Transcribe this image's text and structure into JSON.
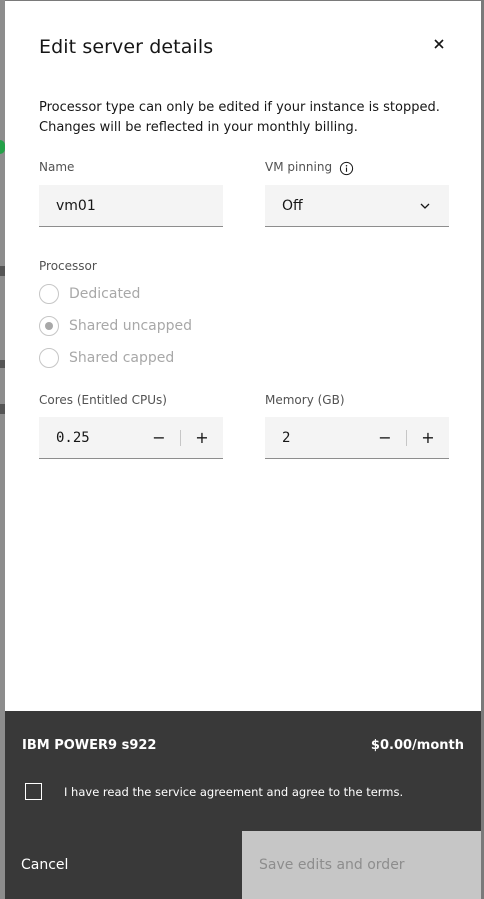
{
  "modal": {
    "title": "Edit server details",
    "description": "Processor type can only be edited if your instance is stopped. Changes will be reflected in your monthly billing.",
    "close_icon": "close-icon"
  },
  "form": {
    "name": {
      "label": "Name",
      "value": "vm01"
    },
    "vm_pinning": {
      "label": "VM pinning",
      "value": "Off",
      "info_icon": "info-icon"
    },
    "processor": {
      "label": "Processor",
      "options": [
        {
          "label": "Dedicated",
          "checked": false,
          "disabled": true
        },
        {
          "label": "Shared uncapped",
          "checked": true,
          "disabled": true
        },
        {
          "label": "Shared capped",
          "checked": false,
          "disabled": true
        }
      ]
    },
    "cores": {
      "label": "Cores (Entitled CPUs)",
      "value": "0.25",
      "decrement": "−",
      "increment": "+"
    },
    "memory": {
      "label": "Memory (GB)",
      "value": "2",
      "decrement": "−",
      "increment": "+"
    }
  },
  "footer": {
    "product": "IBM POWER9 s922",
    "price": "$0.00/month",
    "agreement": "I have read the service agreement and agree to the terms.",
    "cancel_label": "Cancel",
    "save_label": "Save edits and order"
  },
  "colors": {
    "footer_bg": "#393939",
    "field_bg": "#f4f4f4",
    "disabled_button": "#c6c6c6"
  }
}
